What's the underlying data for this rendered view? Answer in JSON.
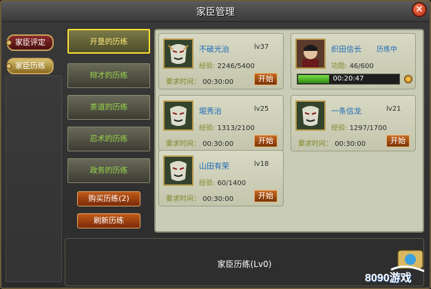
{
  "window": {
    "title": "家臣管理"
  },
  "sidebar": {
    "tabs": [
      {
        "label": "家臣评定"
      },
      {
        "label": "家臣历练"
      }
    ]
  },
  "categories": {
    "items": [
      {
        "label": "开垦的历练",
        "active": true
      },
      {
        "label": "辩才的历练",
        "active": false
      },
      {
        "label": "茶道的历练",
        "active": false
      },
      {
        "label": "忍术的历练",
        "active": false
      },
      {
        "label": "政务的历练",
        "active": false
      }
    ],
    "buy_label": "购买历练(2)",
    "refresh_label": "刷新历练"
  },
  "cards": [
    {
      "name": "不破光治",
      "level": "lv37",
      "exp_label": "经验:",
      "exp_value": "2246/5400",
      "req_label": "要求时间：",
      "req_value": "00:30:00",
      "button": "开始"
    },
    {
      "name": "织田信长",
      "status": "历练中",
      "level": "",
      "exp_label": "功勋:",
      "exp_value": "46/600",
      "progress_text": "00:20:47",
      "progress_fraction": 0.31
    },
    {
      "name": "堀秀治",
      "level": "lv25",
      "exp_label": "经验:",
      "exp_value": "1313/2100",
      "req_label": "要求时间：",
      "req_value": "00:30:00",
      "button": "开始"
    },
    {
      "name": "一条信龙",
      "level": "lv21",
      "exp_label": "经验:",
      "exp_value": "1297/1700",
      "req_label": "要求时间：",
      "req_value": "00:30:00",
      "button": "开始"
    },
    {
      "name": "山田有荣",
      "level": "lv18",
      "exp_label": "经验:",
      "exp_value": "60/1400",
      "req_label": "要求时间：",
      "req_value": "00:30:00",
      "button": "开始"
    }
  ],
  "bottom": {
    "text": "家臣历练(Lv0)"
  },
  "watermark": {
    "text": "8090游戏"
  },
  "colors": {
    "accent_yellow": "#ffe230",
    "name_blue": "#1b6ab8",
    "label_green": "#9ad84a"
  }
}
